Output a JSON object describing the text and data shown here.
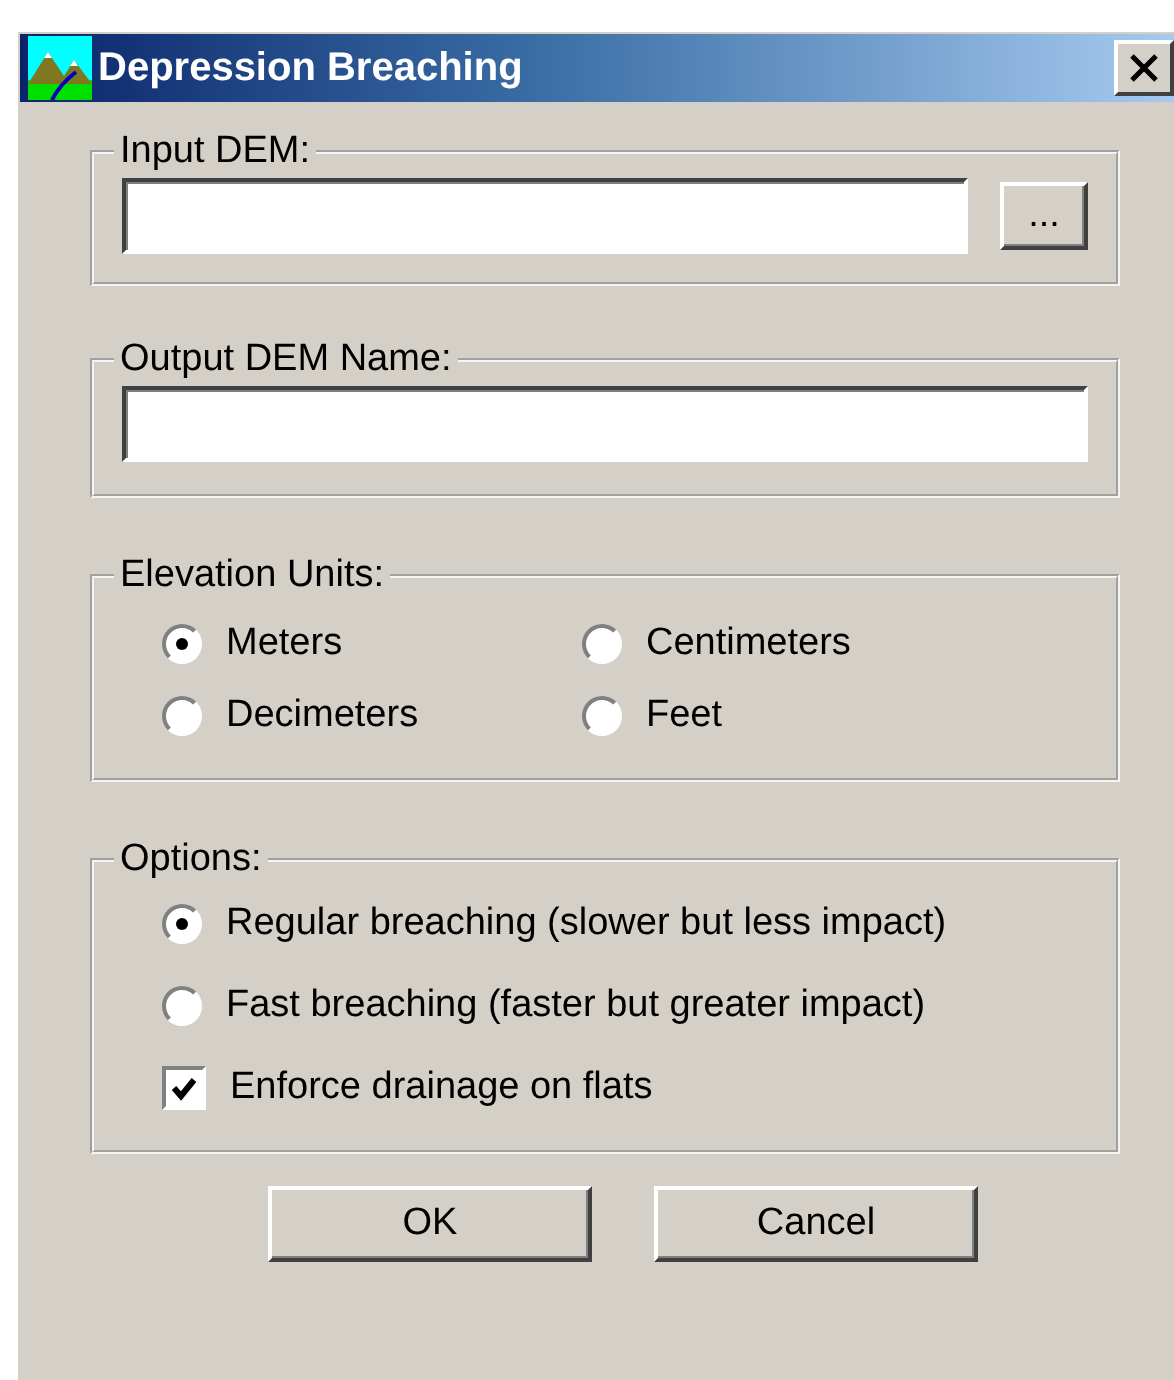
{
  "window": {
    "title": "Depression Breaching"
  },
  "input_dem": {
    "label": "Input DEM:",
    "browse": "..."
  },
  "output_dem": {
    "label": "Output DEM Name:"
  },
  "elevation_units": {
    "label": "Elevation Units:",
    "options": [
      {
        "label": "Meters",
        "selected": true
      },
      {
        "label": "Centimeters",
        "selected": false
      },
      {
        "label": "Decimeters",
        "selected": false
      },
      {
        "label": "Feet",
        "selected": false
      }
    ]
  },
  "options": {
    "label": "Options:",
    "items": [
      {
        "kind": "radio",
        "label": "Regular breaching (slower but less impact)",
        "selected": true
      },
      {
        "kind": "radio",
        "label": "Fast breaching (faster but greater impact)",
        "selected": false
      },
      {
        "kind": "checkbox",
        "label": "Enforce drainage on flats",
        "checked": true
      }
    ]
  },
  "buttons": [
    "OK",
    "Cancel"
  ]
}
